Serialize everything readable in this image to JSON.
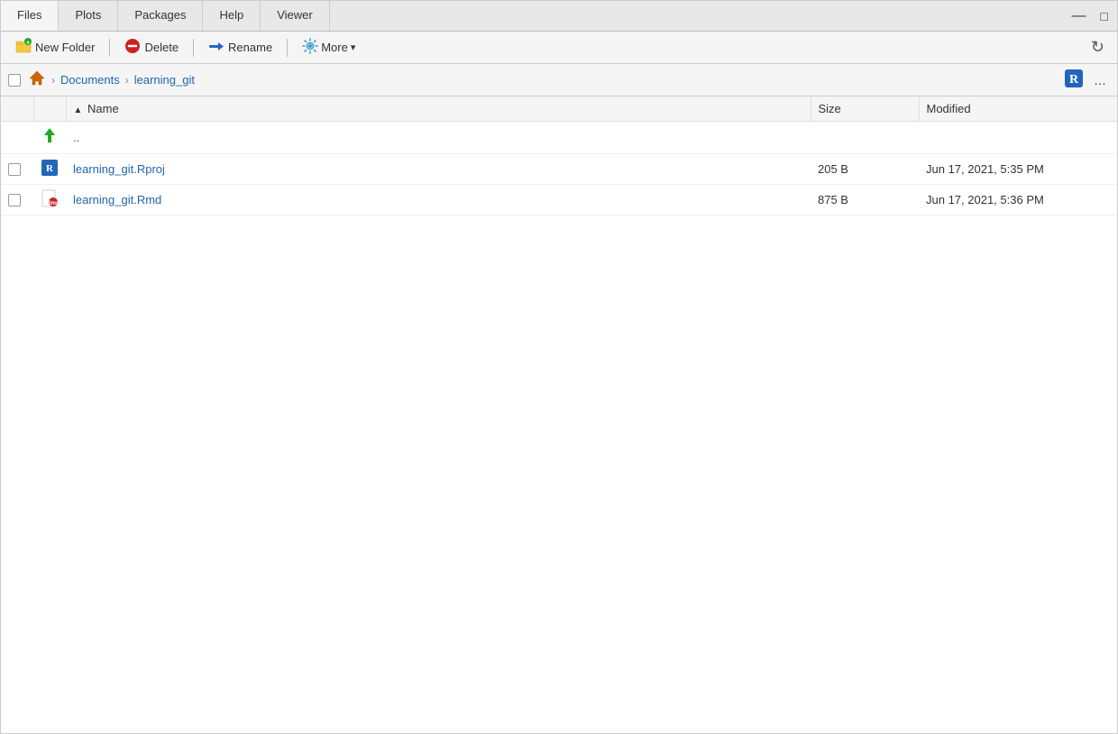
{
  "tabs": [
    {
      "id": "files",
      "label": "Files",
      "active": true
    },
    {
      "id": "plots",
      "label": "Plots",
      "active": false
    },
    {
      "id": "packages",
      "label": "Packages",
      "active": false
    },
    {
      "id": "help",
      "label": "Help",
      "active": false
    },
    {
      "id": "viewer",
      "label": "Viewer",
      "active": false
    }
  ],
  "toolbar": {
    "new_folder_label": "New Folder",
    "delete_label": "Delete",
    "rename_label": "Rename",
    "more_label": "More",
    "more_arrow": "▾"
  },
  "breadcrumb": {
    "home_label": "Home",
    "sep1": "›",
    "documents_label": "Documents",
    "sep2": "›",
    "current_label": "learning_git",
    "more_label": "…"
  },
  "table": {
    "col_name_label": "Name",
    "col_size_label": "Size",
    "col_modified_label": "Modified",
    "sort_arrow": "▲"
  },
  "files": [
    {
      "id": "parent",
      "name": "..",
      "size": "",
      "modified": "",
      "type": "parent"
    },
    {
      "id": "rproj",
      "name": "learning_git.Rproj",
      "size": "205 B",
      "modified": "Jun 17, 2021, 5:35 PM",
      "type": "rproj"
    },
    {
      "id": "rmd",
      "name": "learning_git.Rmd",
      "size": "875 B",
      "modified": "Jun 17, 2021, 5:36 PM",
      "type": "rmd"
    }
  ]
}
